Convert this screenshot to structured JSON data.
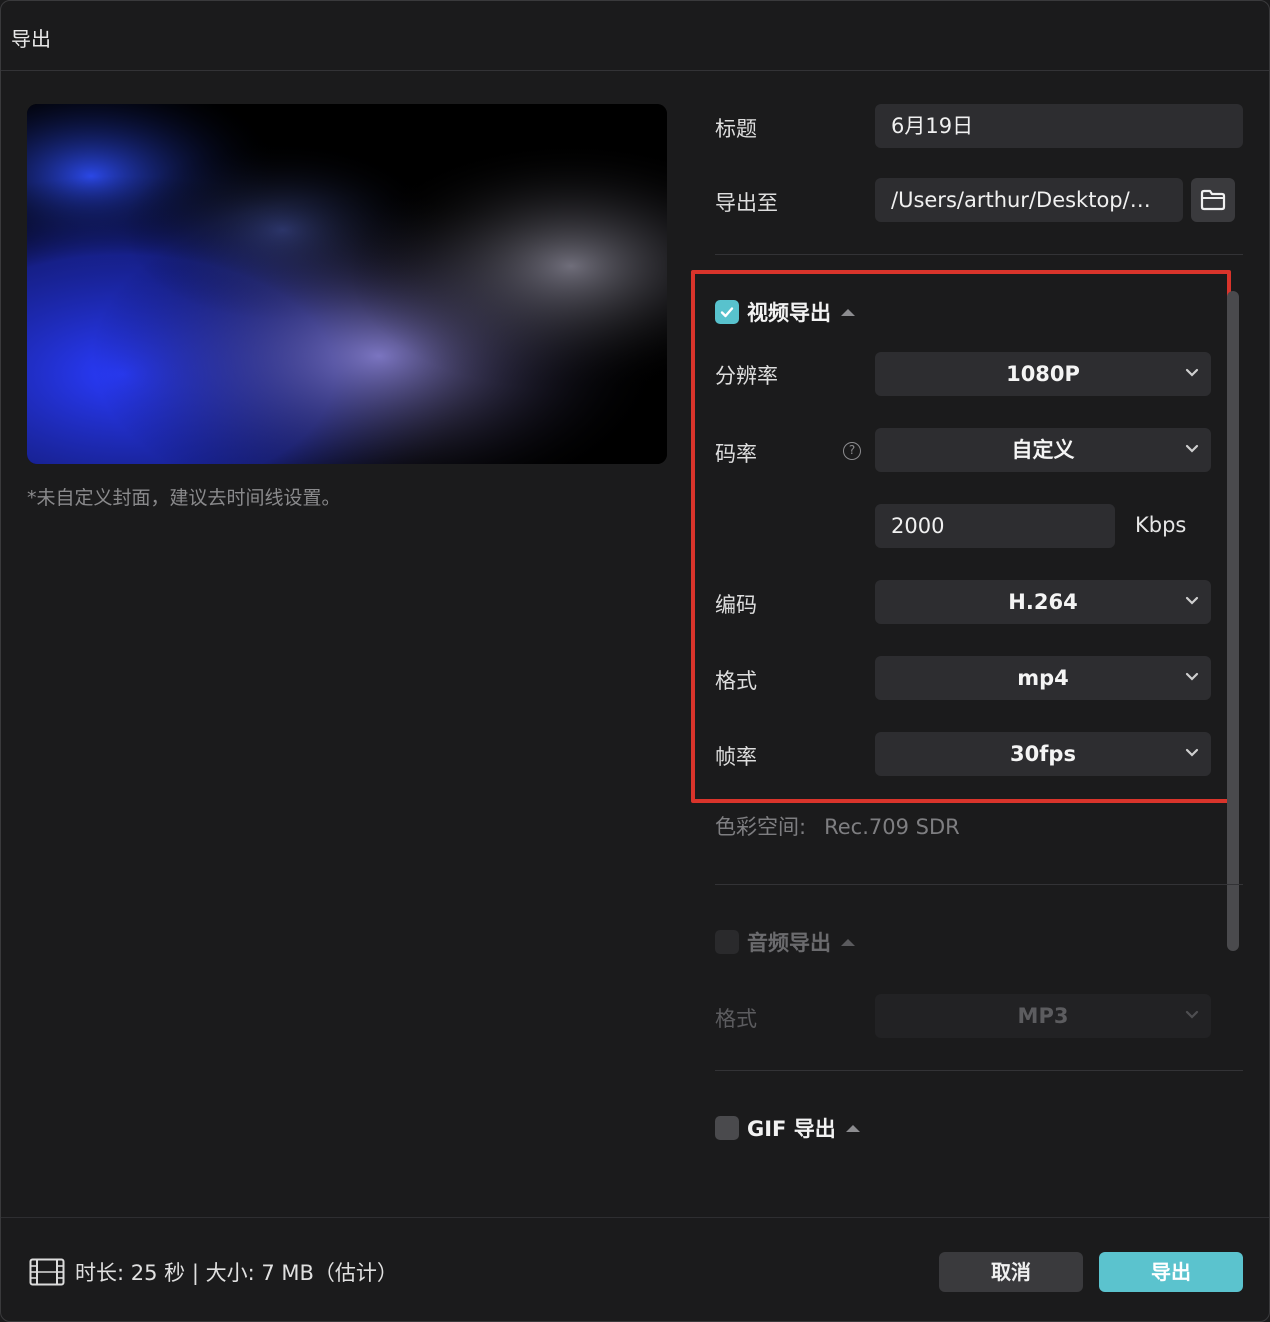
{
  "window": {
    "title": "导出"
  },
  "preview": {
    "cover_hint": "*未自定义封面，建议去时间线设置。"
  },
  "form": {
    "title_label": "标题",
    "title_value": "6月19日",
    "export_to_label": "导出至",
    "export_to_value": "/Users/arthur/Desktop/…"
  },
  "video": {
    "section_title": "视频导出",
    "checked": true,
    "resolution_label": "分辨率",
    "resolution_value": "1080P",
    "bitrate_label": "码率",
    "bitrate_help": "?",
    "bitrate_value": "自定义",
    "bitrate_kbps_value": "2000",
    "bitrate_unit": "Kbps",
    "codec_label": "编码",
    "codec_value": "H.264",
    "format_label": "格式",
    "format_value": "mp4",
    "framerate_label": "帧率",
    "framerate_value": "30fps",
    "colorspace_label": "色彩空间:",
    "colorspace_value": "Rec.709 SDR"
  },
  "audio": {
    "section_title": "音频导出",
    "checked": false,
    "format_label": "格式",
    "format_value": "MP3"
  },
  "gif": {
    "section_title": "GIF 导出",
    "checked": false
  },
  "footer": {
    "info": "时长: 25 秒 | 大小: 7 MB（估计）",
    "cancel_label": "取消",
    "export_label": "导出"
  },
  "colors": {
    "accent": "#5bc3ce",
    "highlight_border": "#d9342b",
    "background": "#1b1b1c"
  },
  "icons": [
    "folder-icon",
    "check-icon",
    "chevron-down-icon",
    "caret-up-icon",
    "help-icon",
    "film-icon"
  ]
}
